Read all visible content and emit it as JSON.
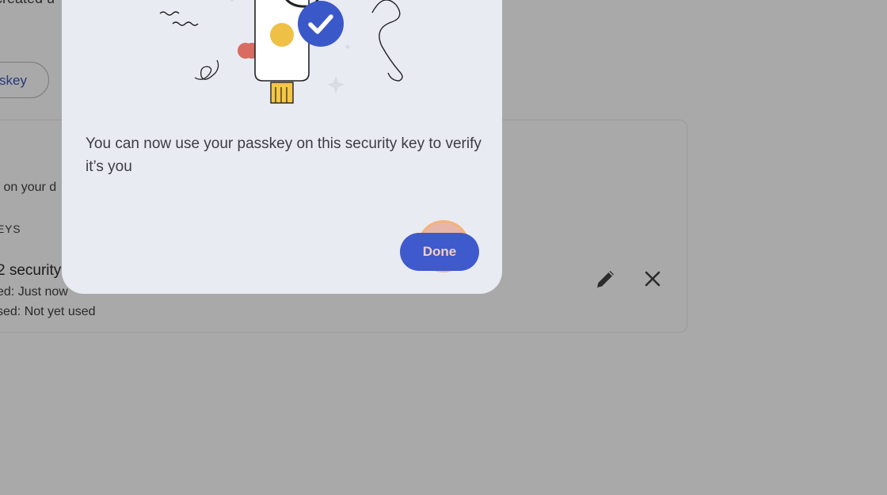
{
  "background": {
    "top_text": "created u",
    "pill_label": "skey",
    "card": {
      "subtitle": "s on your d",
      "section_header": "EYS",
      "key_name": "2 security",
      "created": "ed: Just now",
      "last_used": "sed: Not yet used"
    }
  },
  "dialog": {
    "message": "You can now use your passkey on this security key to verify it’s you",
    "done_label": "Done"
  },
  "colors": {
    "scrim": "#a9a9a9",
    "dialog_bg": "#e9ebf2",
    "primary": "#3e5acc",
    "check_badge": "#3b58c9",
    "coin": "#eec046",
    "click_indicator": "#e88a6c"
  },
  "icons": {
    "edit": "pencil-icon",
    "delete": "close-icon",
    "badge": "checkmark-icon"
  }
}
